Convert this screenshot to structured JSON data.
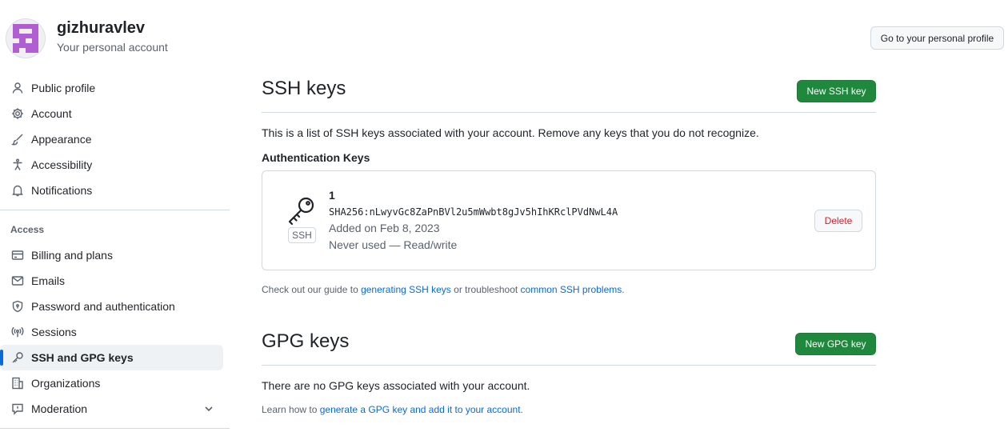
{
  "header": {
    "username": "gizhuravlev",
    "subtitle": "Your personal account",
    "profile_button": "Go to your personal profile"
  },
  "sidebar": {
    "items": [
      {
        "label": "Public profile",
        "icon": "person-icon"
      },
      {
        "label": "Account",
        "icon": "gear-icon"
      },
      {
        "label": "Appearance",
        "icon": "paintbrush-icon"
      },
      {
        "label": "Accessibility",
        "icon": "accessibility-icon"
      },
      {
        "label": "Notifications",
        "icon": "bell-icon"
      }
    ],
    "access_label": "Access",
    "access_items": [
      {
        "label": "Billing and plans",
        "icon": "credit-card-icon"
      },
      {
        "label": "Emails",
        "icon": "mail-icon"
      },
      {
        "label": "Password and authentication",
        "icon": "shield-lock-icon"
      },
      {
        "label": "Sessions",
        "icon": "broadcast-icon"
      },
      {
        "label": "SSH and GPG keys",
        "icon": "key-icon",
        "active": true
      },
      {
        "label": "Organizations",
        "icon": "organization-icon"
      },
      {
        "label": "Moderation",
        "icon": "report-icon"
      }
    ]
  },
  "ssh": {
    "title": "SSH keys",
    "new_button": "New SSH key",
    "intro": "This is a list of SSH keys associated with your account. Remove any keys that you do not recognize.",
    "auth_heading": "Authentication Keys",
    "key": {
      "badge": "SSH",
      "title": "1",
      "fingerprint": "SHA256:nLwyvGc8ZaPnBVl2u5mWwbt8gJv5hIhKRclPVdNwL4A",
      "added": "Added on Feb 8, 2023",
      "usage": "Never used — Read/write",
      "delete_button": "Delete"
    },
    "note_prefix": "Check out our guide to ",
    "note_link1": "generating SSH keys",
    "note_middle": " or troubleshoot ",
    "note_link2": "common SSH problems",
    "note_suffix": "."
  },
  "gpg": {
    "title": "GPG keys",
    "new_button": "New GPG key",
    "empty": "There are no GPG keys associated with your account.",
    "note_prefix": "Learn how to ",
    "note_link": "generate a GPG key and add it to your account",
    "note_suffix": "."
  },
  "colors": {
    "accent": "#0969da",
    "primary_button": "#1f883d",
    "danger": "#d1242f",
    "avatar": "#b15ed3"
  }
}
